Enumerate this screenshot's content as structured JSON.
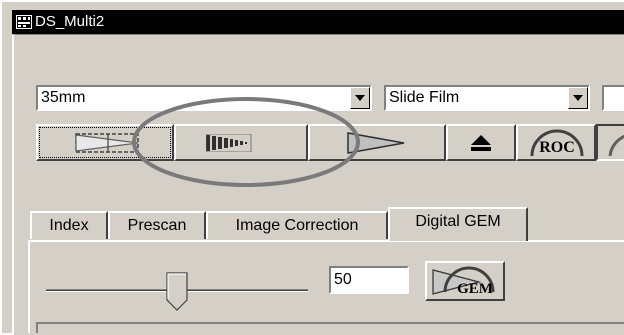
{
  "window": {
    "title": "DS_Multi2",
    "icon": "app-film-icon"
  },
  "film_format": {
    "value": "35mm"
  },
  "film_type": {
    "value": "Slide Film"
  },
  "toolbar": {
    "buttons": [
      {
        "name": "prescan-button",
        "icon": "film-frame-icon"
      },
      {
        "name": "index-scan-button",
        "icon": "film-strip-icon"
      },
      {
        "name": "scan-button",
        "icon": "play-arrow-icon"
      },
      {
        "name": "eject-button",
        "icon": "eject-icon"
      },
      {
        "name": "roc-button",
        "icon": "roc-icon",
        "label": "ROC"
      }
    ]
  },
  "tabs": [
    {
      "label": "Index"
    },
    {
      "label": "Prescan"
    },
    {
      "label": "Image Correction"
    },
    {
      "label": "Digital GEM",
      "active": true
    }
  ],
  "gem": {
    "slider_value": 50,
    "value_text": "50",
    "button_label": "GEM"
  },
  "colors": {
    "face": "#d4d0c8",
    "highlight": "#ffffff",
    "shadow": "#808080",
    "dark": "#404040",
    "ellipse": "#7a7a7a"
  }
}
